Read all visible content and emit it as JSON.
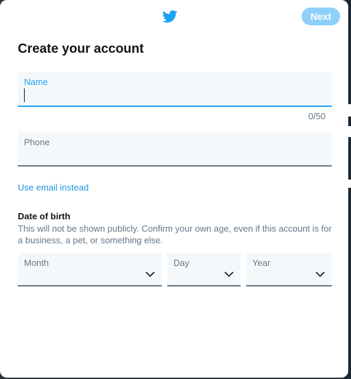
{
  "header": {
    "logo_icon": "twitter-bird-icon",
    "next_label": "Next"
  },
  "title": "Create your account",
  "name_field": {
    "label": "Name",
    "value": "",
    "counter": "0/50"
  },
  "phone_field": {
    "label": "Phone",
    "value": ""
  },
  "use_email_link": "Use email instead",
  "dob": {
    "title": "Date of birth",
    "description": "This will not be shown publicly. Confirm your own age, even if this account is for a business, a pet, or something else.",
    "month_label": "Month",
    "day_label": "Day",
    "year_label": "Year"
  },
  "colors": {
    "accent": "#1da1f2",
    "next_disabled": "#8ed0f9",
    "field_bg": "#f5f8fa",
    "muted_text": "#657786"
  }
}
